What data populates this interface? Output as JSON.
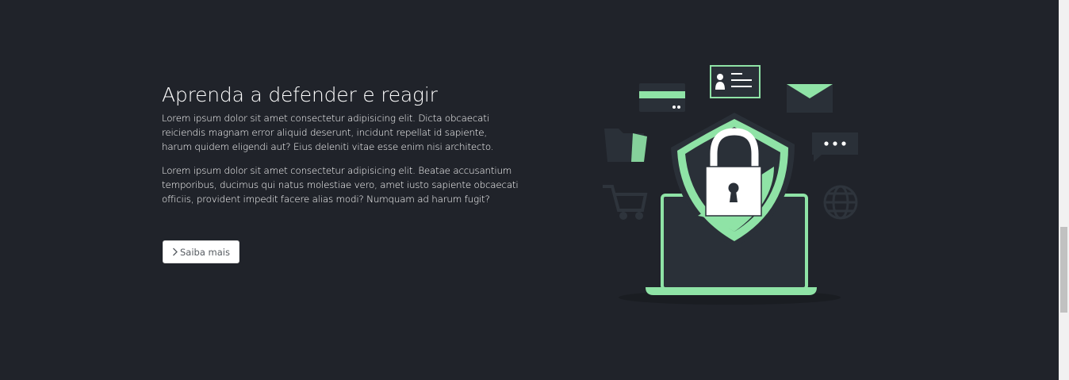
{
  "hero": {
    "title": "Aprenda a defender e reagir",
    "paragraphs": [
      "Lorem ipsum dolor sit amet consectetur adipisicing elit. Dicta obcaecati reiciendis magnam error aliquid deserunt, incidunt repellat id sapiente, harum quidem eligendi aut? Eius deleniti vitae esse enim nisi architecto.",
      "Lorem ipsum dolor sit amet consectetur adipisicing elit. Beatae accusantium temporibus, ducimus qui natus molestiae vero, amet iusto sapiente obcaecati officiis, provident impedit facere alias modi? Numquam ad harum fugit?"
    ],
    "button_label": "Saiba mais",
    "button_icon": "chevron-right-icon"
  },
  "illustration": {
    "name": "security-illustration",
    "icons": [
      "id-card-icon",
      "credit-card-icon",
      "envelope-icon",
      "folder-icon",
      "chat-bubble-icon",
      "shopping-cart-icon",
      "globe-icon",
      "shield-icon",
      "padlock-icon",
      "laptop-icon"
    ]
  },
  "colors": {
    "background": "#20232a",
    "accent": "#8fe3a6",
    "panel": "#2a3038",
    "button_bg": "#ffffff"
  }
}
